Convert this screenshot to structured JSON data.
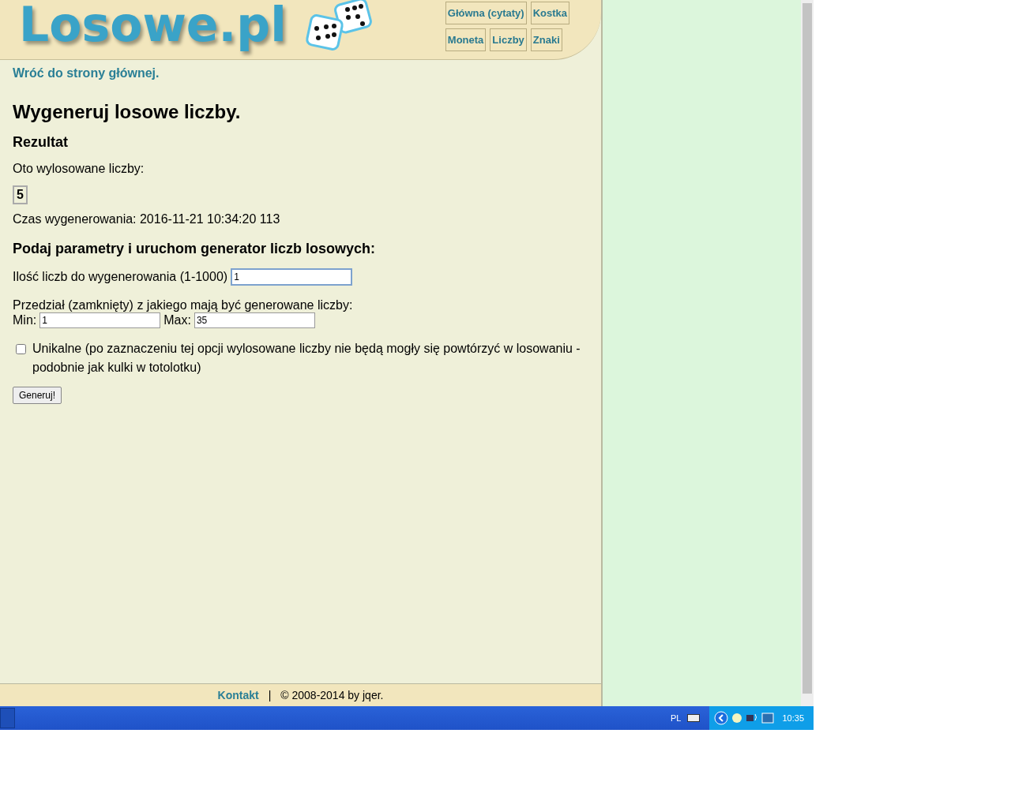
{
  "header": {
    "logo": "Losowe.pl",
    "nav": [
      [
        {
          "label": "Główna (cytaty)"
        },
        {
          "label": "Kostka"
        }
      ],
      [
        {
          "label": "Moneta"
        },
        {
          "label": "Liczby"
        },
        {
          "label": "Znaki"
        }
      ]
    ]
  },
  "back_link": "Wróć do strony głównej.",
  "title": "Wygeneruj losowe liczby.",
  "result": {
    "heading": "Rezultat",
    "label": "Oto wylosowane liczby:",
    "numbers": [
      "5"
    ],
    "time": "Czas wygenerowania: 2016-11-21 10:34:20 113"
  },
  "form": {
    "heading": "Podaj parametry i uruchom generator liczb losowych:",
    "count": {
      "label": "Ilość liczb do wygenerowania (1-1000)",
      "value": "1",
      "focused": true
    },
    "range_label": "Przedział (zamknięty) z jakiego mają być generowane liczby:",
    "min": {
      "label": "Min:",
      "value": "1"
    },
    "max": {
      "label": "Max:",
      "value": "35"
    },
    "unique": {
      "checked": false,
      "label": "Unikalne (po zaznaczeniu tej opcji wylosowane liczby nie będą mogły się powtórzyć w losowaniu - podobnie jak kulki w totolotku)"
    },
    "button": "Generuj!"
  },
  "footer": {
    "link": "Kontakt",
    "separator": "|",
    "copyright": "© 2008-2014 by jqer."
  },
  "taskbar": {
    "language": "PL",
    "clock": "10:35"
  }
}
